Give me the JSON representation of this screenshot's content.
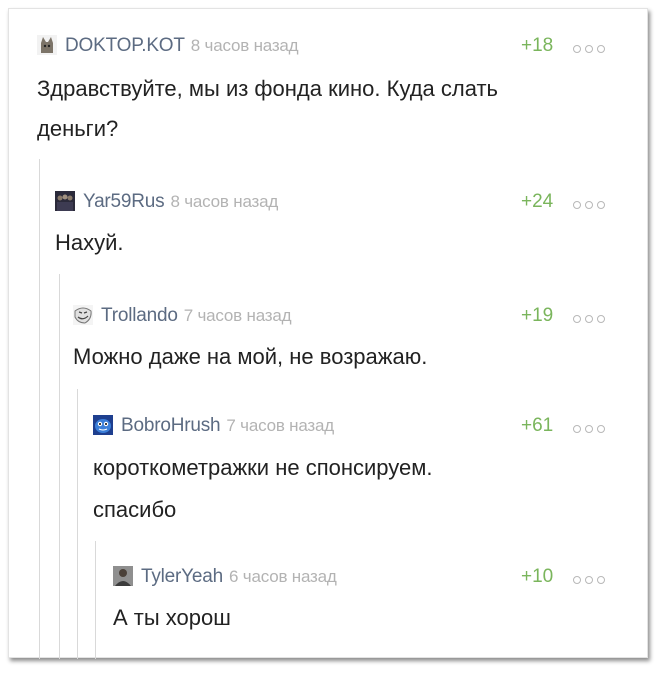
{
  "comments": [
    {
      "author": "DOKTOP.KOT",
      "time": "8 часов назад",
      "rating": "+18",
      "text_lines": [
        "Здравствуйте, мы из фонда кино. Куда слать",
        "деньги?"
      ],
      "avatar_icon": "cat-icon"
    },
    {
      "author": "Yar59Rus",
      "time": "8 часов назад",
      "rating": "+24",
      "text_lines": [
        "Нахуй."
      ],
      "avatar_icon": "crowd-icon"
    },
    {
      "author": "Trollando",
      "time": "7 часов назад",
      "rating": "+19",
      "text_lines": [
        "Можно даже на мой, не возражаю."
      ],
      "avatar_icon": "trollface-icon"
    },
    {
      "author": "BobroHrush",
      "time": "7 часов назад",
      "rating": "+61",
      "text_lines": [
        "короткометражки не спонсируем.",
        "спасибо"
      ],
      "avatar_icon": "blue-face-icon"
    },
    {
      "author": "TylerYeah",
      "time": "6 часов назад",
      "rating": "+10",
      "text_lines": [
        "А ты хорош"
      ],
      "avatar_icon": "person-icon"
    }
  ],
  "colors": {
    "author": "#5c6b82",
    "time": "#b3b3b3",
    "rating_positive": "#7ab55c",
    "thread_line": "#d9d9d9"
  }
}
